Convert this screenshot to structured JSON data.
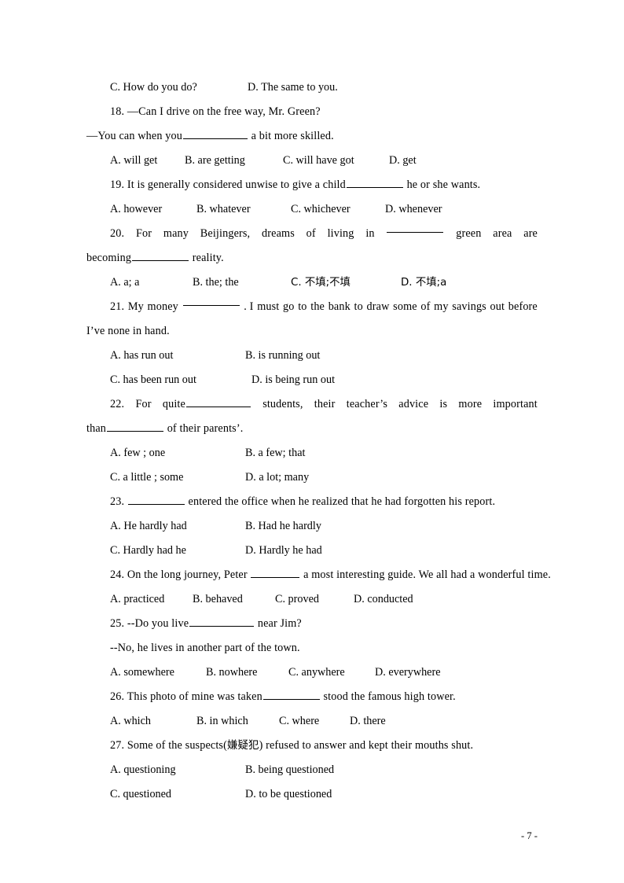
{
  "document": {
    "type": "exam-paper",
    "page_footer": "- 7 -"
  },
  "questions": [
    {
      "id": "q17-options-tail",
      "kind": "options-only",
      "rows": [
        {
          "cells": [
            "C. How do you do?",
            "D. The same to you."
          ],
          "widths": [
            175,
            0
          ]
        }
      ]
    },
    {
      "id": "q18",
      "number": "18.",
      "stem_line1": "18. —Can I drive on the free way, Mr. Green?",
      "stem_line2_pre": "—You can when you",
      "stem_line2_post": " a bit more skilled.",
      "options_inline": [
        "A. will get",
        "B. are getting",
        "C. will have got",
        "D. get"
      ],
      "option_widths": [
        95,
        125,
        135,
        0
      ]
    },
    {
      "id": "q19",
      "stem_pre": "19. It is generally considered unwise to give a child",
      "stem_post": " he or she wants.",
      "options_inline": [
        "A. however",
        "B. whatever",
        "C. whichever",
        "D. whenever"
      ],
      "option_widths": [
        110,
        120,
        120,
        0
      ]
    },
    {
      "id": "q20",
      "justified_words": [
        "20.",
        "For",
        "many",
        "Beijingers,",
        "dreams",
        "of",
        "living",
        "in",
        "BLANK",
        "green",
        "area",
        "are"
      ],
      "continuation_pre": "becoming",
      "continuation_post": " reality.",
      "options_inline": [
        "A. a; a",
        "B. the; the",
        "C. 不填;不填",
        "D. 不填;a"
      ],
      "option_widths": [
        105,
        125,
        140,
        0
      ]
    },
    {
      "id": "q21",
      "justified_words": [
        "21.",
        "My",
        "money",
        "BLANK",
        ". I",
        "must",
        "go",
        "to",
        "the",
        "bank",
        "to",
        "draw",
        "some",
        "of",
        "my",
        "savings",
        "out",
        "before"
      ],
      "continuation": "I’ve   none in hand.",
      "options_grid": [
        {
          "cells": [
            "A. has run out",
            "B. is running out"
          ],
          "widths": [
            172,
            0
          ]
        },
        {
          "cells": [
            "C. has been run out",
            "D. is being run out"
          ],
          "widths": [
            180,
            0
          ]
        }
      ]
    },
    {
      "id": "q22",
      "justified_words": [
        "22.",
        "For",
        "quiteBLANK",
        "students,",
        "their",
        "teacher’s",
        "advice",
        "is",
        "more",
        "important"
      ],
      "continuation_pre": "than",
      "continuation_post": " of their parents’.",
      "options_grid": [
        {
          "cells": [
            "A. few ; one",
            "B. a few; that"
          ],
          "widths": [
            172,
            0
          ]
        },
        {
          "cells": [
            "C. a little ; some",
            "D. a lot; many"
          ],
          "widths": [
            172,
            0
          ]
        }
      ]
    },
    {
      "id": "q23",
      "stem_pre": "23. ",
      "stem_post": " entered the office when he realized that he had forgotten his report.",
      "options_grid": [
        {
          "cells": [
            "A. He hardly had",
            "B. Had he hardly"
          ],
          "widths": [
            172,
            0
          ]
        },
        {
          "cells": [
            "C. Hardly had he",
            "D. Hardly he had"
          ],
          "widths": [
            172,
            0
          ]
        }
      ]
    },
    {
      "id": "q24",
      "stem_pre": "24. On the long journey, Peter ",
      "stem_post": " a most interesting guide. We all had a wonderful time.",
      "options_inline": [
        "A. practiced",
        "B. behaved",
        "C. proved",
        "D. conducted"
      ],
      "option_widths": [
        105,
        105,
        100,
        0
      ]
    },
    {
      "id": "q25",
      "stem_pre": "25. --Do you live",
      "stem_post": " near Jim?",
      "stem_line2": "--No, he lives in another part of the town.",
      "options_inline": [
        "A. somewhere",
        "B. nowhere",
        "C. anywhere",
        "D. everywhere"
      ],
      "option_widths": [
        122,
        105,
        110,
        0
      ]
    },
    {
      "id": "q26",
      "stem_pre": "26. This photo of mine was taken",
      "stem_post": " stood the famous high tower.",
      "options_inline": [
        "A. which",
        "B. in which",
        "C. where",
        "D. there"
      ],
      "option_widths": [
        110,
        105,
        90,
        0
      ]
    },
    {
      "id": "q27",
      "stem": "27. Some of the suspects(嫌疑犯) refused to answer and kept their mouths shut.",
      "stem_pre": "27. Some of the suspects(",
      "stem_cjk": "嫌疑犯",
      "stem_post": ") refused to answer and kept their mouths shut.",
      "options_grid": [
        {
          "cells": [
            "A. questioning",
            "B. being questioned"
          ],
          "widths": [
            172,
            0
          ]
        },
        {
          "cells": [
            "C. questioned",
            "D. to be questioned"
          ],
          "widths": [
            172,
            0
          ]
        }
      ]
    }
  ]
}
